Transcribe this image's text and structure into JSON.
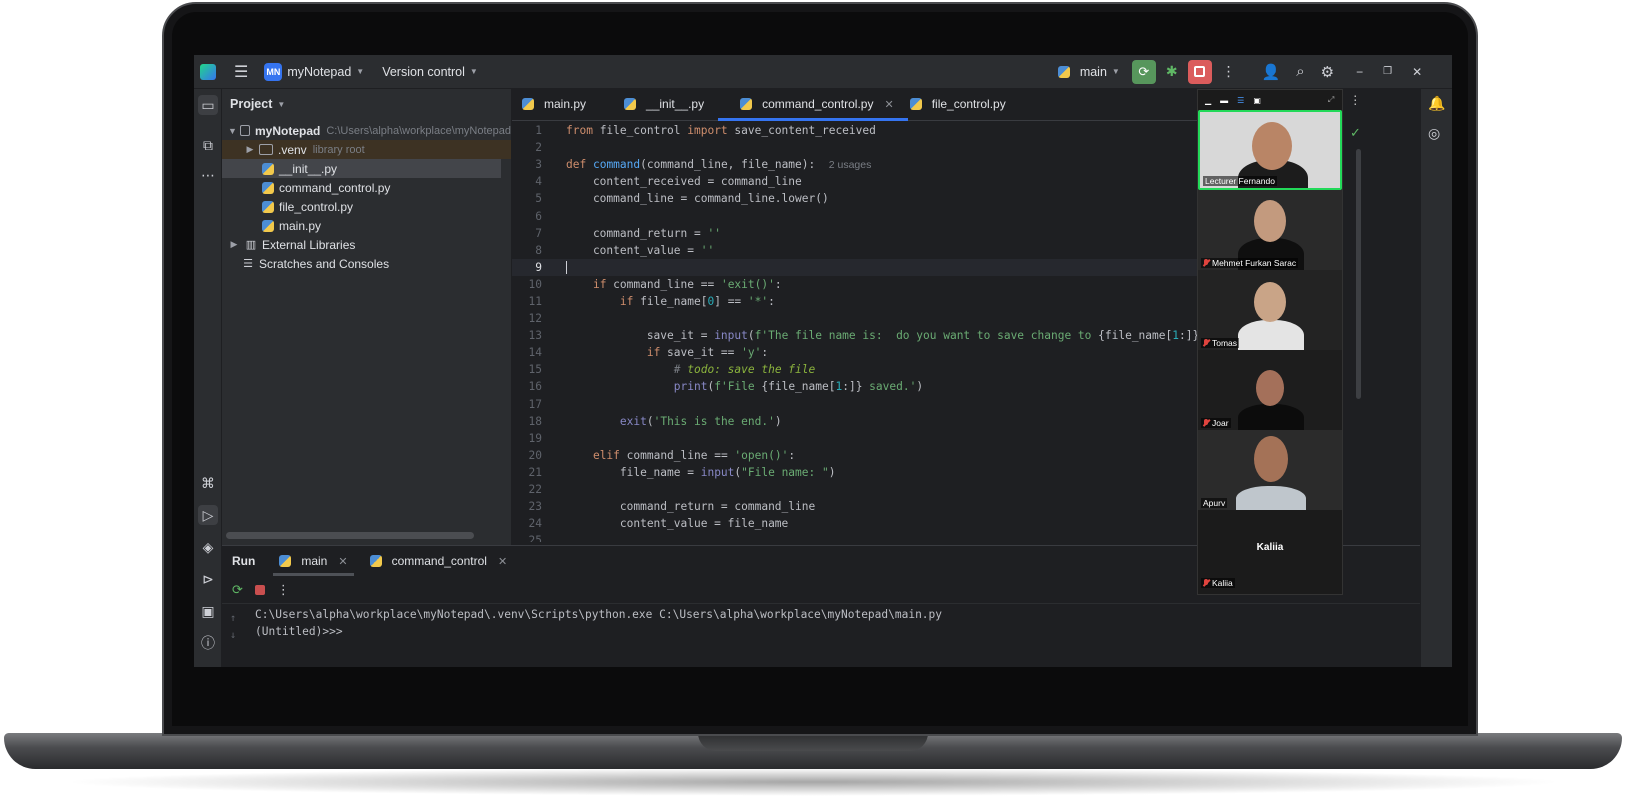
{
  "titlebar": {
    "project_badge": "MN",
    "project_name": "myNotepad",
    "vcs": "Version control",
    "branch": "main"
  },
  "project_panel": {
    "header": "Project",
    "root": "myNotepad",
    "root_path": "C:\\Users\\alpha\\workplace\\myNotepad",
    "items": [
      {
        "label": ".venv",
        "hint": "library root"
      },
      {
        "label": "__init__.py"
      },
      {
        "label": "command_control.py"
      },
      {
        "label": "file_control.py"
      },
      {
        "label": "main.py"
      },
      {
        "label": "External Libraries"
      },
      {
        "label": "Scratches and Consoles"
      }
    ]
  },
  "editor": {
    "tabs": [
      "main.py",
      "__init__.py",
      "command_control.py",
      "file_control.py"
    ],
    "active_tab": "command_control.py",
    "usages_hint": "2 usages",
    "lines": [
      "1",
      "2",
      "3",
      "4",
      "5",
      "6",
      "7",
      "8",
      "9",
      "10",
      "11",
      "12",
      "13",
      "14",
      "15",
      "16",
      "17",
      "18",
      "19",
      "20",
      "21",
      "22",
      "23",
      "24",
      "25"
    ]
  },
  "run_panel": {
    "title": "Run",
    "tabs": [
      "main",
      "command_control"
    ],
    "console_lines": [
      "C:\\Users\\alpha\\workplace\\myNotepad\\.venv\\Scripts\\python.exe C:\\Users\\alpha\\workplace\\myNotepad\\main.py",
      "(Untitled)>>>"
    ]
  },
  "meeting": {
    "participants": [
      {
        "name": "Lecturer Fernando",
        "muted": false,
        "active": true
      },
      {
        "name": "Mehmet Furkan Sarac",
        "muted": true
      },
      {
        "name": "Tomas",
        "muted": true
      },
      {
        "name": "Joar",
        "muted": true
      },
      {
        "name": "Apurv",
        "muted": false
      },
      {
        "name": "Kaliia",
        "muted": true
      }
    ],
    "kaliia_center": "Kaliia"
  },
  "colors": {
    "accent": "#3574f0",
    "run_green": "#57965c",
    "stop_red": "#db5c5c",
    "speaker_border": "#23d959"
  }
}
